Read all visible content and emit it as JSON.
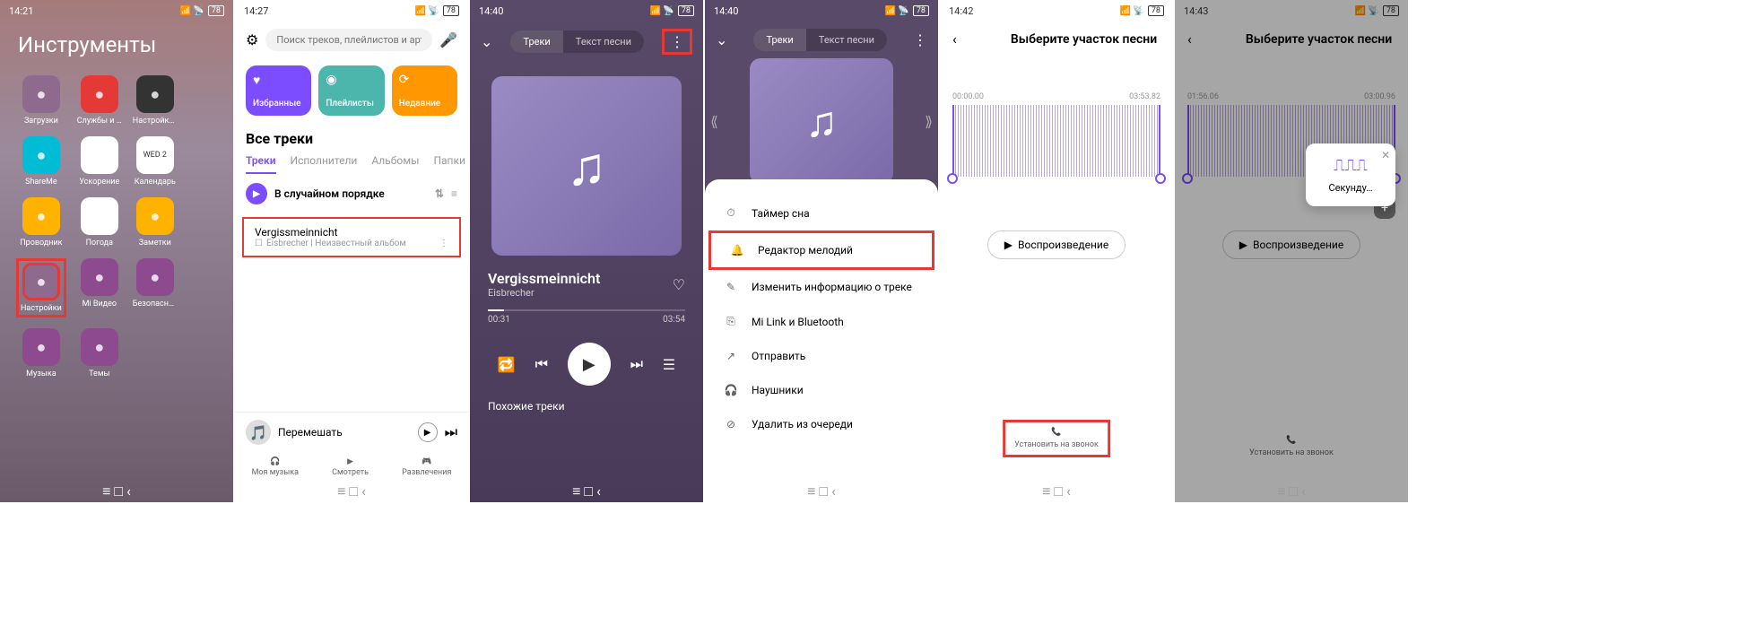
{
  "status": {
    "t1": "14:21",
    "t2": "14:27",
    "t3": "14:40",
    "t4": "14:40",
    "t5": "14:42",
    "t6": "14:43",
    "battery": "78"
  },
  "s1": {
    "title": "Инструменты",
    "apps": [
      {
        "label": "Загрузки",
        "color": "#8e6a8e"
      },
      {
        "label": "Службы и обратная св...",
        "color": "#e53935"
      },
      {
        "label": "Настройки рабочего ст...",
        "color": "#333"
      },
      {
        "label": ""
      },
      {
        "label": "ShareMe",
        "color": "#00bcd4"
      },
      {
        "label": "Ускорение",
        "color": "#fff"
      },
      {
        "label": "Календарь",
        "color": "#fff",
        "text": "WED 2"
      },
      {
        "label": ""
      },
      {
        "label": "Проводник",
        "color": "#ffb300"
      },
      {
        "label": "Погода",
        "color": "#fff"
      },
      {
        "label": "Заметки",
        "color": "#ffb300"
      },
      {
        "label": ""
      },
      {
        "label": "Настройки",
        "color": "#8e6a8e"
      },
      {
        "label": "Mi Видео",
        "color": "#8e4a8e"
      },
      {
        "label": "Безопасность",
        "color": "#8e4a8e"
      },
      {
        "label": ""
      },
      {
        "label": "Музыка",
        "color": "#8e4a8e"
      },
      {
        "label": "Темы",
        "color": "#8e4a8e"
      }
    ]
  },
  "s2": {
    "search_placeholder": "Поиск треков, плейлистов и артистов",
    "cards": [
      {
        "label": "Избранные",
        "color": "#7c4dff"
      },
      {
        "label": "Плейлисты",
        "color": "#4db6ac"
      },
      {
        "label": "Недавние",
        "color": "#ff9800"
      }
    ],
    "section": "Все треки",
    "tabs": [
      "Треки",
      "Исполнители",
      "Альбомы",
      "Папки"
    ],
    "shuffle": "В случайном порядке",
    "track": {
      "title": "Vergissmeinnicht",
      "sub": "Eisbrecher | Неизвестный альбом"
    },
    "player": {
      "label": "Перемешать"
    },
    "nav": [
      {
        "label": "Моя музыка"
      },
      {
        "label": "Смотреть"
      },
      {
        "label": "Развлечения"
      }
    ]
  },
  "s3": {
    "tabs": [
      "Треки",
      "Текст песни"
    ],
    "title": "Vergissmeinnicht",
    "artist": "Eisbrecher",
    "time_cur": "00:31",
    "time_total": "03:54",
    "similar": "Похожие треки"
  },
  "s4": {
    "tabs": [
      "Треки",
      "Текст песни"
    ],
    "menu": [
      {
        "icon": "timer",
        "label": "Таймер сна"
      },
      {
        "icon": "bell",
        "label": "Редактор мелодий",
        "hl": true
      },
      {
        "icon": "edit",
        "label": "Изменить информацию о треке"
      },
      {
        "icon": "link",
        "label": "Mi Link и Bluetooth"
      },
      {
        "icon": "share",
        "label": "Отправить"
      },
      {
        "icon": "headphone",
        "label": "Наушники"
      },
      {
        "icon": "trash",
        "label": "Удалить из очереди"
      }
    ]
  },
  "s5": {
    "title": "Выберите участок песни",
    "start": "00:00.00",
    "end": "03:53.82",
    "play": "Воспроизведение",
    "action": "Установить на звонок"
  },
  "s6": {
    "title": "Выберите участок песни",
    "start": "01:56.06",
    "end": "03:00.96",
    "play": "Воспроизведение",
    "action": "Установить на звонок",
    "toast": "Секунду…"
  }
}
